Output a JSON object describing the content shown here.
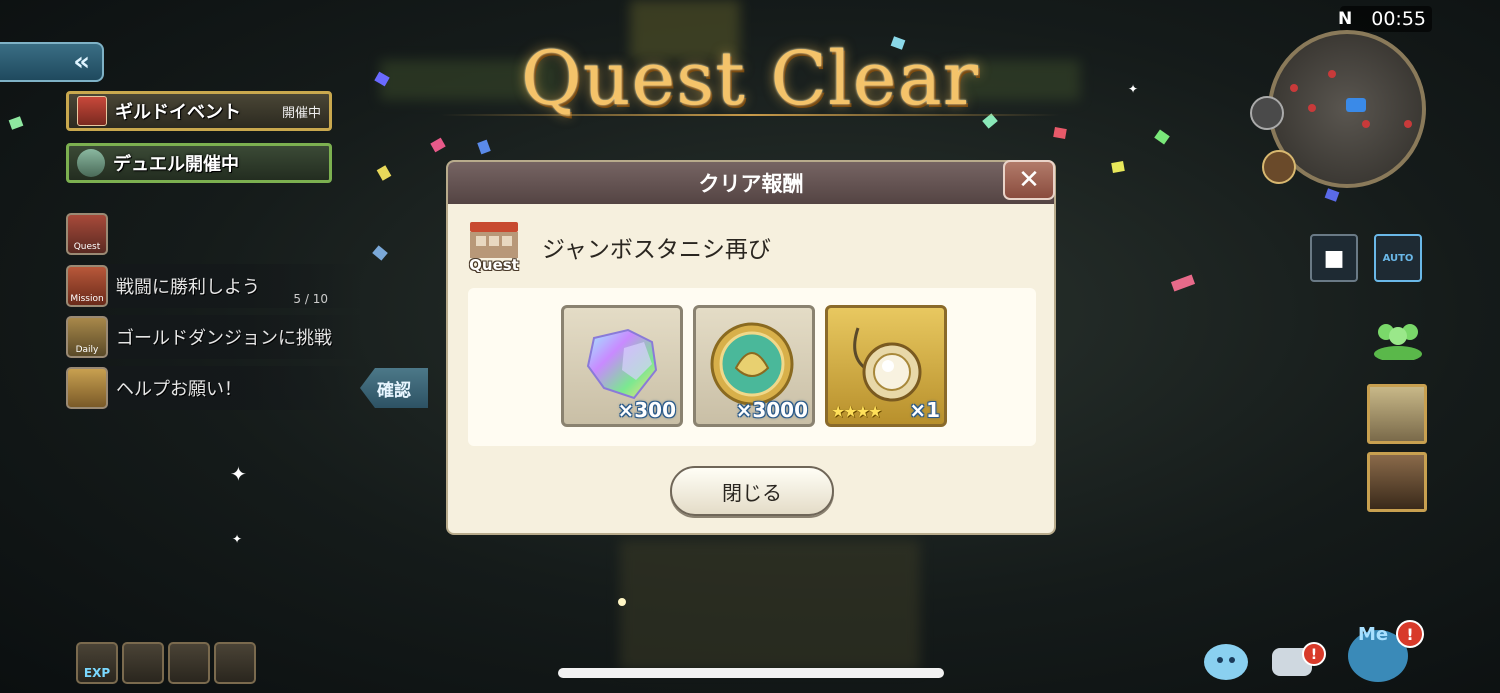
{
  "hud": {
    "timer": "00:55",
    "map_north": "N"
  },
  "events": {
    "guild_label": "ギルドイベント",
    "guild_status": "開催中",
    "duel_label": "デュエル開催中"
  },
  "missions": [
    {
      "tag": "Quest",
      "text": "",
      "count": ""
    },
    {
      "tag": "Mission",
      "text": "戦闘に勝利しよう",
      "count": "5 / 10"
    },
    {
      "tag": "Daily",
      "text": "ゴールドダンジョンに挑戦",
      "count": ""
    },
    {
      "tag": "",
      "text": "ヘルプお願い！",
      "count": ""
    }
  ],
  "confirm_label": "確認",
  "title": "Quest Clear",
  "dialog": {
    "header": "クリア報酬",
    "quest_icon_label": "Quest",
    "quest_name": "ジャンボスタニシ再び",
    "rewards": [
      {
        "icon": "rainbow-crystal-icon",
        "qty": "×300",
        "stars": ""
      },
      {
        "icon": "gold-coin-icon",
        "qty": "×3000",
        "stars": ""
      },
      {
        "icon": "accessory-orb-icon",
        "qty": "×1",
        "stars": "★★★★"
      }
    ],
    "close_label": "閉じる"
  },
  "right_buttons": {
    "auto_label": "AUTO",
    "me_label": "Me"
  },
  "bottom_bar": {
    "exp_label": "EXP"
  },
  "colors": {
    "title_gold": "#f4c36a",
    "dialog_bg": "#f6f0de",
    "header_bg": "#6a5858",
    "qty_outline": "#2a5a8a"
  }
}
